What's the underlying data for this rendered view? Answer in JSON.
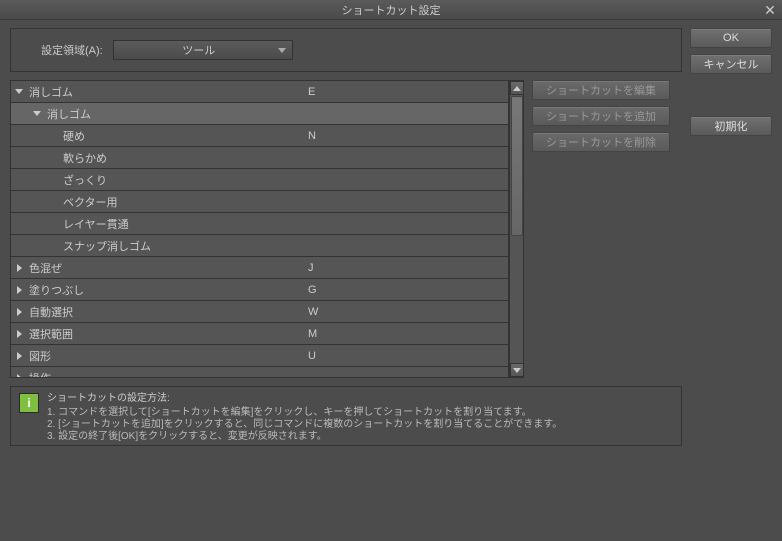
{
  "title": "ショートカット設定",
  "area": {
    "label": "設定領域(A):",
    "value": "ツール"
  },
  "tree": [
    {
      "label": "消しゴム",
      "key": "E",
      "indent": 0,
      "expander": "down",
      "sel": false
    },
    {
      "label": "消しゴム",
      "key": "",
      "indent": 1,
      "expander": "down",
      "sel": true
    },
    {
      "label": "硬め",
      "key": "N",
      "indent": 2,
      "expander": "",
      "sel": false
    },
    {
      "label": "軟らかめ",
      "key": "",
      "indent": 2,
      "expander": "",
      "sel": false
    },
    {
      "label": "ざっくり",
      "key": "",
      "indent": 2,
      "expander": "",
      "sel": false
    },
    {
      "label": "ベクター用",
      "key": "",
      "indent": 2,
      "expander": "",
      "sel": false
    },
    {
      "label": "レイヤー貫通",
      "key": "",
      "indent": 2,
      "expander": "",
      "sel": false
    },
    {
      "label": "スナップ消しゴム",
      "key": "",
      "indent": 2,
      "expander": "",
      "sel": false
    },
    {
      "label": "色混ぜ",
      "key": "J",
      "indent": 0,
      "expander": "right",
      "sel": false
    },
    {
      "label": "塗りつぶし",
      "key": "G",
      "indent": 0,
      "expander": "right",
      "sel": false
    },
    {
      "label": "自動選択",
      "key": "W",
      "indent": 0,
      "expander": "right",
      "sel": false
    },
    {
      "label": "選択範囲",
      "key": "M",
      "indent": 0,
      "expander": "right",
      "sel": false
    },
    {
      "label": "図形",
      "key": "U",
      "indent": 0,
      "expander": "right",
      "sel": false
    },
    {
      "label": "操作",
      "key": "",
      "indent": 0,
      "expander": "right",
      "sel": false
    }
  ],
  "actions": {
    "edit": "ショートカットを編集",
    "add": "ショートカットを追加",
    "del": "ショートカットを削除"
  },
  "buttons": {
    "ok": "OK",
    "cancel": "キャンセル",
    "reset": "初期化"
  },
  "info": {
    "header": "ショートカットの設定方法:",
    "l1": "1. コマンドを選択して[ショートカットを編集]をクリックし、キーを押してショートカットを割り当てます。",
    "l2": "2. [ショートカットを追加]をクリックすると、同じコマンドに複数のショートカットを割り当てることができます。",
    "l3": "3. 設定の終了後[OK]をクリックすると、変更が反映されます。"
  }
}
